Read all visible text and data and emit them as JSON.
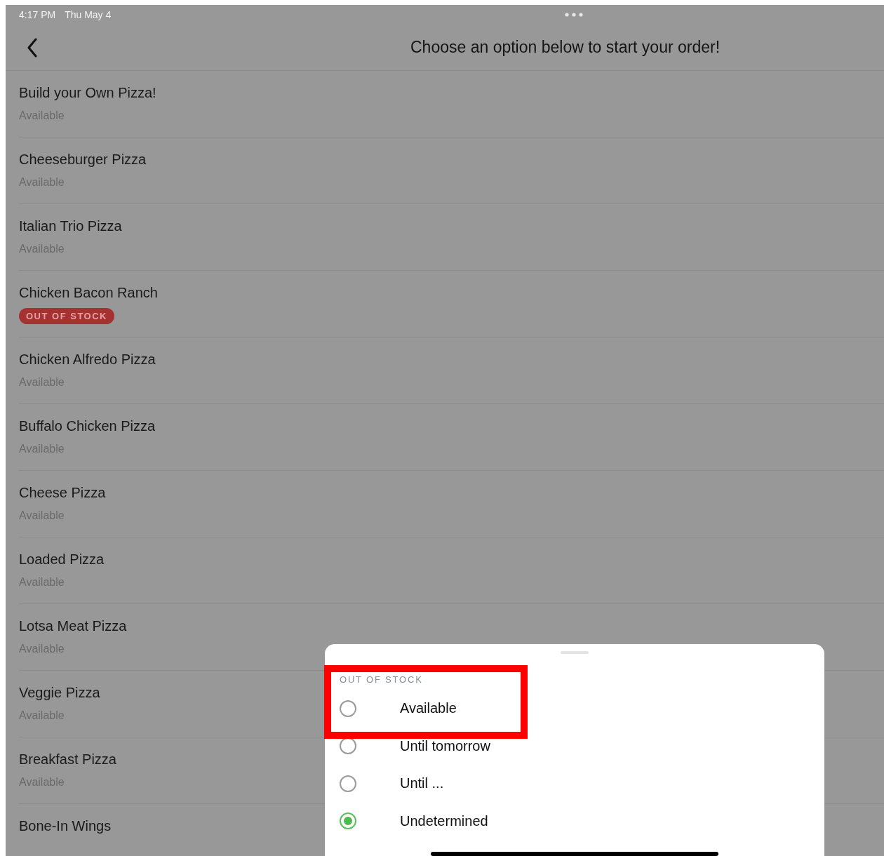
{
  "status_bar": {
    "time": "4:17 PM",
    "date": "Thu May 4"
  },
  "nav": {
    "title": "Choose an option below to start your order!"
  },
  "items": [
    {
      "name": "Build your Own Pizza!",
      "status": {
        "kind": "available",
        "text": "Available"
      }
    },
    {
      "name": "Cheeseburger Pizza",
      "status": {
        "kind": "available",
        "text": "Available"
      }
    },
    {
      "name": "Italian Trio Pizza",
      "status": {
        "kind": "available",
        "text": "Available"
      }
    },
    {
      "name": "Chicken Bacon Ranch",
      "status": {
        "kind": "out_of_stock",
        "text": "OUT OF STOCK"
      }
    },
    {
      "name": "Chicken Alfredo Pizza",
      "status": {
        "kind": "available",
        "text": "Available"
      }
    },
    {
      "name": "Buffalo Chicken Pizza",
      "status": {
        "kind": "available",
        "text": "Available"
      }
    },
    {
      "name": "Cheese Pizza",
      "status": {
        "kind": "available",
        "text": "Available"
      }
    },
    {
      "name": "Loaded Pizza",
      "status": {
        "kind": "available",
        "text": "Available"
      }
    },
    {
      "name": "Lotsa Meat Pizza",
      "status": {
        "kind": "available",
        "text": "Available"
      }
    },
    {
      "name": "Veggie Pizza",
      "status": {
        "kind": "available",
        "text": "Available"
      }
    },
    {
      "name": "Breakfast Pizza",
      "status": {
        "kind": "available",
        "text": "Available"
      }
    },
    {
      "name": "Bone-In Wings"
    }
  ],
  "sheet": {
    "header": "OUT OF STOCK",
    "options": [
      {
        "label": "Available",
        "selected": false
      },
      {
        "label": "Until tomorrow",
        "selected": false
      },
      {
        "label": "Until ...",
        "selected": false
      },
      {
        "label": "Undetermined",
        "selected": true
      }
    ]
  }
}
